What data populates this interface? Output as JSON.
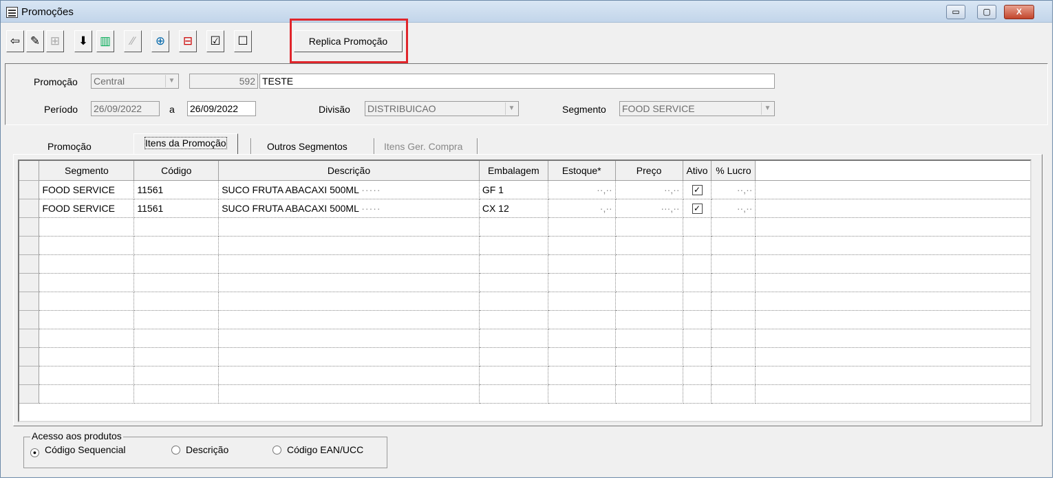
{
  "window": {
    "title": "Promoções",
    "minimize": "▭",
    "maximize": "▢",
    "close": "X"
  },
  "toolbar": {
    "icons": [
      "exit-icon",
      "edit-icon",
      "disabled-icon",
      "import-icon",
      "grid-icon",
      "disabled-icon",
      "add-row-icon",
      "remove-row-icon",
      "check-list-icon",
      "uncheck-list-icon"
    ],
    "replica_label": "Replica Promoção"
  },
  "form": {
    "promocao_label": "Promoção",
    "promocao_type": "Central",
    "promocao_number": "592",
    "promocao_name": "TESTE",
    "periodo_label": "Período",
    "periodo_start": "26/09/2022",
    "periodo_a": "a",
    "periodo_end": "26/09/2022",
    "divisao_label": "Divisão",
    "divisao_value": "DISTRIBUICAO",
    "segmento_label": "Segmento",
    "segmento_value": "FOOD SERVICE"
  },
  "tabs": [
    "Promoção",
    "Itens da Promoção",
    "Outros Segmentos",
    "Itens Ger. Compra"
  ],
  "grid": {
    "columns": [
      "Segmento",
      "Código",
      "Descrição",
      "Embalagem",
      "Estoque*",
      "Preço",
      "Ativo",
      "% Lucro"
    ],
    "rows": [
      {
        "segmento": "FOOD SERVICE",
        "codigo": "11561",
        "descricao": "SUCO FRUTA ABACAXI 500ML",
        "desc_blur": "·····",
        "embalagem": "GF 1",
        "estoque": "··,··",
        "preco": "··,··",
        "ativo": "✓",
        "lucro": "··,··"
      },
      {
        "segmento": "FOOD SERVICE",
        "codigo": "11561",
        "descricao": "SUCO FRUTA ABACAXI 500ML",
        "desc_blur": "·····",
        "embalagem": "CX 12",
        "estoque": "·,··",
        "preco": "···,··",
        "ativo": "✓",
        "lucro": "··,··"
      }
    ]
  },
  "access": {
    "legend": "Acesso aos produtos",
    "options": [
      "Código Sequencial",
      "Descrição",
      "Código EAN/UCC"
    ],
    "selected": "Código Sequencial"
  }
}
